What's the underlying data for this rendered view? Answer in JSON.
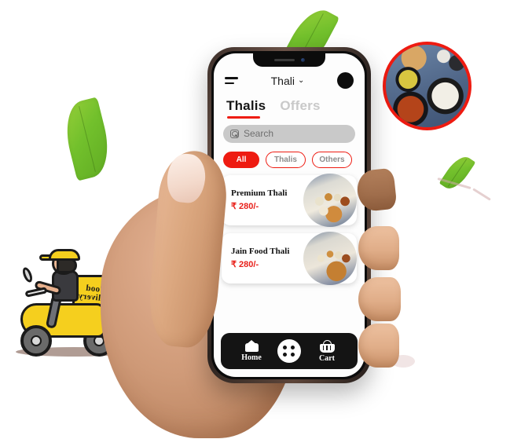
{
  "app": {
    "appbar": {
      "menu_icon": "hamburger-icon",
      "title": "Thali",
      "chevron": "⌄",
      "avatar_icon": "avatar-circle"
    },
    "tabs": [
      {
        "label": "Thalis",
        "active": true
      },
      {
        "label": "Offers",
        "active": false
      }
    ],
    "search": {
      "icon": "search-icon",
      "placeholder": "Search",
      "value": ""
    },
    "filters": [
      {
        "label": "All",
        "selected": true
      },
      {
        "label": "Thalis",
        "selected": false
      },
      {
        "label": "Others",
        "selected": false
      }
    ],
    "items": [
      {
        "name": "Premium Thali",
        "price": "₹ 280/-",
        "thumb": "premium-thali-photo"
      },
      {
        "name": "Jain Food Thali",
        "price": "₹ 280/-",
        "thumb": "jain-food-thali-photo"
      }
    ],
    "bottom_nav": [
      {
        "label": "Home",
        "icon": "home-icon"
      },
      {
        "label": "",
        "icon": "grid-dots-icon"
      },
      {
        "label": "Cart",
        "icon": "cart-basket-icon"
      }
    ]
  },
  "decor": {
    "hero_photo": "indian-thali-photo",
    "scooter": {
      "box_line1": "Food",
      "box_line2": "Delivery"
    },
    "leaves": [
      "leaf-top",
      "leaf-left",
      "leaf-right"
    ]
  },
  "colors": {
    "brand_red": "#ee1b11",
    "price_red": "#e8201a",
    "nav_dark": "#141414",
    "search_gray": "#c9c9c9",
    "inactive_tab": "#c9c9c9",
    "leaf_green": "#72c02c",
    "scooter_yellow": "#f5cf1e"
  }
}
